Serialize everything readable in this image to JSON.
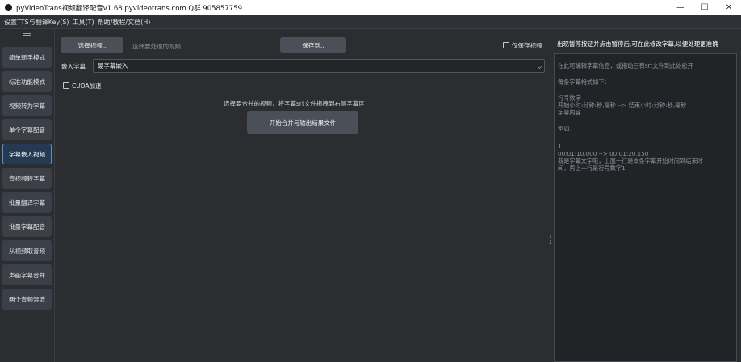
{
  "window": {
    "title": "pyVideoTrans视频翻译配音v1.68 pyvideotrans.com  Q群 905857759",
    "controls": {
      "minimize": "—",
      "maximize": "☐",
      "close": "✕"
    }
  },
  "menubar": {
    "items": [
      {
        "label": "设置TTS与翻译Key(S)"
      },
      {
        "label": "工具(T)"
      },
      {
        "label": "帮助/教程/文档(H)"
      }
    ]
  },
  "sidebar": {
    "items": [
      {
        "label": "简单新手模式",
        "active": false
      },
      {
        "label": "标准功能模式",
        "active": false
      },
      {
        "label": "视频转为字幕",
        "active": false
      },
      {
        "label": "单个字幕配音",
        "active": false
      },
      {
        "label": "字幕嵌入视频",
        "active": true
      },
      {
        "label": "音视频转字幕",
        "active": false
      },
      {
        "label": "批量翻译字幕",
        "active": false
      },
      {
        "label": "批量字幕配音",
        "active": false
      },
      {
        "label": "从视频取音频",
        "active": false
      },
      {
        "label": "声画字幕合并",
        "active": false
      },
      {
        "label": "两个音频混流",
        "active": false
      }
    ]
  },
  "main": {
    "select_video_button": "选择视频..",
    "select_video_hint": "选择要处理的视频",
    "save_to_button": "保存到..",
    "keep_video_checkbox": "仅保存视频",
    "embed_label": "嵌入字幕",
    "embed_select_value": "硬字幕嵌入",
    "cuda_checkbox": "CUDA加速",
    "instruction": "选择要合并的视频，将字幕srt文件拖拽到右侧字幕区",
    "start_button": "开始合并与输出结果文件"
  },
  "right_panel": {
    "header": "出现暂停按钮并点击暂停后,可在此修改字幕,以便处理更准确",
    "editor_placeholder_lines": [
      "在此可编辑字幕信息，或拖动已有srt文件到此处松开",
      "",
      "每条字幕格式如下：",
      "",
      "行号数字",
      "开始小时:分钟:秒,毫秒 --> 结束小时:分钟:秒,毫秒",
      "字幕内容",
      "",
      "例如：",
      "",
      "1",
      "00:01:10,000 --> 00:01:20,150",
      "我是字幕文字哦，上面一行是本条字幕开始时间到结束时",
      "间，再上一行是行号数字1"
    ]
  },
  "colors": {
    "background": "#2b2d31",
    "button": "#4b5058",
    "active_border": "#5d8fc4"
  }
}
